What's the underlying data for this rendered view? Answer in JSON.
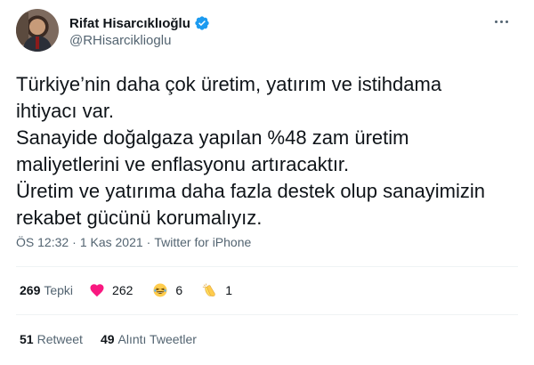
{
  "author": {
    "display_name": "Rifat Hisarcıklıoğlu",
    "handle": "@RHisarciklioglu",
    "verified": true
  },
  "tweet": {
    "lines": [
      "Türkiye’nin daha çok üretim, yatırım ve istihdama",
      "ihtiyacı var.",
      "Sanayide doğalgaza yapılan %48 zam üretim",
      "maliyetlerini ve enflasyonu artıracaktır.",
      "Üretim ve yatırıma daha fazla destek olup sanayimizin",
      "rekabet gücünü korumalıyız."
    ],
    "time": "ÖS 12:32",
    "separator": "·",
    "date": "1 Kas 2021",
    "source": "Twitter for iPhone"
  },
  "reactions": {
    "total_count": "269",
    "total_label": "Tepki",
    "items": [
      {
        "icon": "heart-icon",
        "count": "262"
      },
      {
        "icon": "laughing-face-icon",
        "count": "6"
      },
      {
        "icon": "clapping-hands-icon",
        "count": "1"
      }
    ]
  },
  "engagement": {
    "retweets_count": "51",
    "retweets_label": "Retweet",
    "quotes_count": "49",
    "quotes_label": "Alıntı Tweetler"
  },
  "colors": {
    "text_primary": "#0f1419",
    "text_secondary": "#536471",
    "verified_blue": "#1d9bf0",
    "heart_red": "#f91880",
    "divider": "#eff3f4"
  }
}
